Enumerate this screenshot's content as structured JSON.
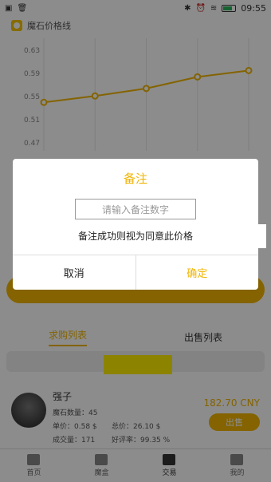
{
  "status_bar": {
    "time": "09:55"
  },
  "chart_header": {
    "title": "魔石价格线"
  },
  "chart_data": {
    "type": "line",
    "title": "魔石价格线",
    "xlabel": "",
    "ylabel": "",
    "y_ticks": [
      "0.63",
      "0.59",
      "0.55",
      "0.51",
      "0.47"
    ],
    "ylim": [
      0.47,
      0.63
    ],
    "series": [
      {
        "values": [
          0.54,
          0.551,
          0.564,
          0.584,
          0.595
        ],
        "color": "#f0b400"
      }
    ],
    "grid": "vertical"
  },
  "tabs": {
    "buy_list": "求购列表",
    "sell_list": "出售列表"
  },
  "user": {
    "name": "强子",
    "stone_count_label": "魔石数量：45",
    "unit_price_label": "单价：0.58 $",
    "total_price_label": "总价：26.10 $",
    "volume_label": "成交量：171",
    "rating_label": "好评率：99.35 %",
    "price": "182.70 CNY",
    "sell_button": "出售"
  },
  "nav": {
    "home": "首页",
    "box": "魔盒",
    "trade": "交易",
    "mine": "我的"
  },
  "dialog": {
    "title": "备注",
    "input_placeholder": "请输入备注数字",
    "message": "备注成功则视为同意此价格",
    "cancel": "取消",
    "confirm": "确定"
  }
}
